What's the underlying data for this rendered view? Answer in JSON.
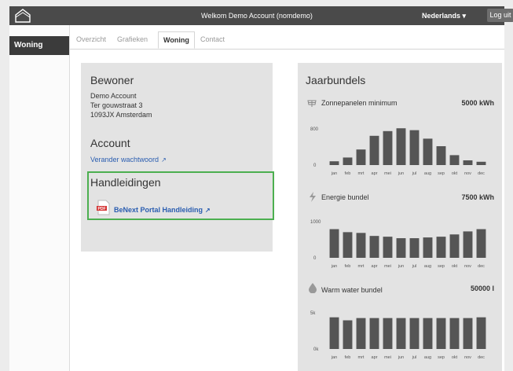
{
  "topbar": {
    "title": "Welkom Demo Account (nomdemo)",
    "language": "Nederlands ▾",
    "logout": "Log uit"
  },
  "sidebar": {
    "active_item": "Woning"
  },
  "tabs": [
    "Overzicht",
    "Grafieken",
    "Woning",
    "Contact"
  ],
  "active_tab": "Woning",
  "bewoner": {
    "heading": "Bewoner",
    "name": "Demo Account",
    "street": "Ter gouwstraat 3",
    "city": "1093JX Amsterdam"
  },
  "account": {
    "heading": "Account",
    "change_password": "Verander wachtwoord"
  },
  "handleidingen": {
    "heading": "Handleidingen",
    "manual": "BeNext Portal Handleiding"
  },
  "jaarbundels": {
    "heading": "Jaarbundels",
    "rows": [
      {
        "label": "Zonnepanelen minimum",
        "value": "5000 kWh",
        "icon": "solar-panel-icon"
      },
      {
        "label": "Energie bundel",
        "value": "7500 kWh",
        "icon": "lightning-icon"
      },
      {
        "label": "Warm water bundel",
        "value": "50000 l",
        "icon": "water-drop-icon"
      }
    ]
  },
  "chart_data": [
    {
      "type": "bar",
      "categories": [
        "jan",
        "feb",
        "mrt",
        "apr",
        "mei",
        "jun",
        "jul",
        "aug",
        "sep",
        "okt",
        "nov",
        "dec"
      ],
      "values": [
        80,
        160,
        330,
        620,
        720,
        780,
        740,
        560,
        400,
        210,
        100,
        70
      ],
      "yticks": [
        "800",
        "0"
      ],
      "ylim": [
        0,
        800
      ]
    },
    {
      "type": "bar",
      "categories": [
        "jan",
        "feb",
        "mrt",
        "apr",
        "mei",
        "jun",
        "jul",
        "aug",
        "sep",
        "okt",
        "nov",
        "dec"
      ],
      "values": [
        760,
        680,
        660,
        580,
        560,
        520,
        520,
        540,
        560,
        620,
        700,
        760
      ],
      "yticks": [
        "1000",
        "0"
      ],
      "ylim": [
        0,
        1000
      ]
    },
    {
      "type": "bar",
      "categories": [
        "jan",
        "feb",
        "mrt",
        "apr",
        "mei",
        "jun",
        "jul",
        "aug",
        "sep",
        "okt",
        "nov",
        "dec"
      ],
      "values": [
        4200,
        3800,
        4100,
        4100,
        4100,
        4100,
        4100,
        4100,
        4100,
        4100,
        4100,
        4200
      ],
      "yticks": [
        "5k",
        "0k"
      ],
      "ylim": [
        0,
        5000
      ]
    }
  ],
  "colors": {
    "bar": "#555555",
    "link": "#2a5db0",
    "highlight": "#4caf50",
    "topbar": "#4a4a4a"
  }
}
